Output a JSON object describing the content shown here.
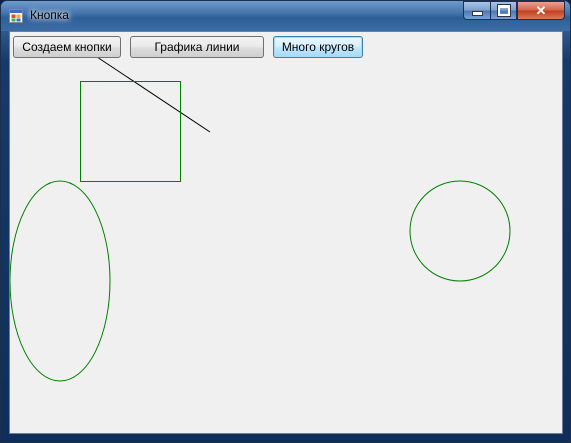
{
  "window": {
    "title": "Кнопка",
    "icons": {
      "app": "form-app-icon",
      "minimize": "minimize-icon",
      "maximize": "maximize-icon",
      "close": "close-icon"
    },
    "close_glyph": "✕"
  },
  "buttons": [
    {
      "label": "Создаем кнопки"
    },
    {
      "label": "Графика линии"
    },
    {
      "label": "Много кругов"
    }
  ],
  "drawing": {
    "line_color": "#000000",
    "shape_color": "#008000",
    "shapes": [
      "line",
      "square",
      "ellipse",
      "circle"
    ]
  }
}
